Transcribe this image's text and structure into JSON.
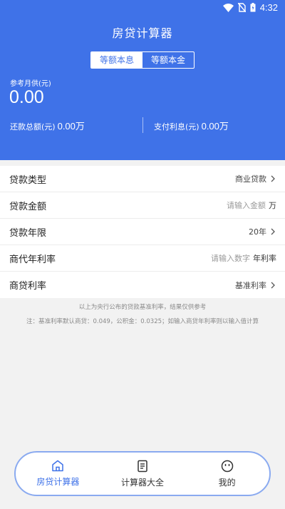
{
  "status_bar": {
    "time": "4:32"
  },
  "header": {
    "title": "房贷计算器",
    "tabs": [
      {
        "label": "等额本息",
        "active": true
      },
      {
        "label": "等额本金",
        "active": false
      }
    ],
    "reference_label": "参考月供(元)",
    "reference_value": "0.00",
    "total_repay_label": "还款总额(元)",
    "total_repay_value": "0.00万",
    "interest_label": "支付利息(元)",
    "interest_value": "0.00万"
  },
  "form": {
    "loan_type": {
      "label": "贷款类型",
      "value": "商业贷款"
    },
    "loan_amount": {
      "label": "贷款金额",
      "placeholder": "请输入金额",
      "unit": "万"
    },
    "loan_years": {
      "label": "贷款年限",
      "value": "20年"
    },
    "agency_rate": {
      "label": "商代年利率",
      "placeholder": "请输入数字",
      "unit": "年利率"
    },
    "commercial_rate": {
      "label": "商贷利率",
      "value": "基准利率"
    }
  },
  "notes": {
    "line1": "以上为央行公布的贷款基准利率，结果仅供参考",
    "line2": "注：基准利率默认商贷：0.049，公积金：0.0325；如输入商贷年利率则以输入值计算"
  },
  "bottom_nav": [
    {
      "label": "房贷计算器",
      "icon": "home-icon",
      "active": true
    },
    {
      "label": "计算器大全",
      "icon": "document-icon",
      "active": false
    },
    {
      "label": "我的",
      "icon": "smiley-icon",
      "active": false
    }
  ],
  "colors": {
    "primary": "#3f72e8",
    "nav_border": "#8aaaf0",
    "background": "#f2f2f2"
  }
}
